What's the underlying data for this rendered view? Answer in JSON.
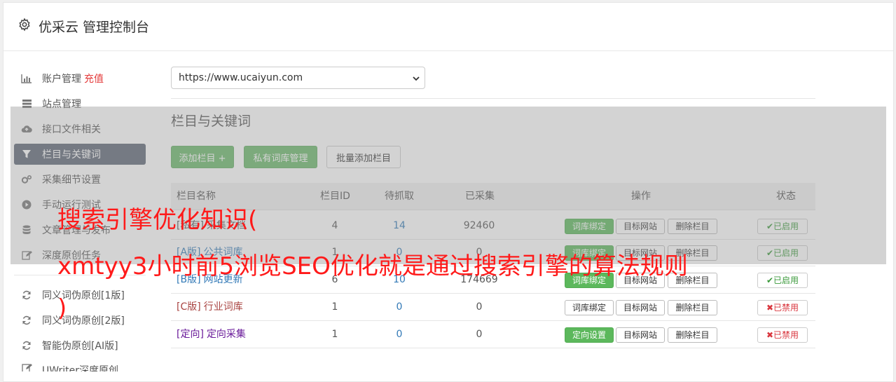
{
  "header": {
    "title": "优采云 管理控制台",
    "icon": "gear-icon"
  },
  "sidebar": {
    "items": [
      {
        "label": "账户管理",
        "highlight": "充值",
        "icon": "bar-chart-icon"
      },
      {
        "label": "站点管理",
        "icon": "server-icon"
      },
      {
        "label": "接口文件相关",
        "icon": "cloud-upload-icon"
      },
      {
        "label": "栏目与关键词",
        "icon": "filter-icon",
        "active": true
      },
      {
        "label": "采集细节设置",
        "icon": "cogs-icon"
      },
      {
        "label": "手动运行测试",
        "icon": "play-circle-icon"
      },
      {
        "label": "文章管理与发布",
        "icon": "database-icon"
      },
      {
        "label": "深度原创任务",
        "icon": "edit-icon"
      },
      {
        "label": "同义词伪原创[1版]",
        "icon": "refresh-icon"
      },
      {
        "label": "同义词伪原创[2版]",
        "icon": "refresh-icon"
      },
      {
        "label": "智能伪原创[AI版]",
        "icon": "refresh-icon"
      },
      {
        "label": "UWriter深度原创",
        "icon": "edit-icon"
      }
    ]
  },
  "site_select": {
    "value": "https://www.ucaiyun.com"
  },
  "section": {
    "title": "栏目与关键词",
    "buttons": {
      "add": "添加栏目 +",
      "private": "私有词库管理",
      "batch": "批量添加栏目"
    }
  },
  "table": {
    "headers": [
      "栏目名称",
      "栏目ID",
      "待抓取",
      "已采集",
      "操作",
      "状态"
    ],
    "rows": [
      {
        "tag": "[私有]",
        "name": "采集文档",
        "tag_color": "#555555",
        "id": "4",
        "pending": "14",
        "collected": "92460",
        "btn1": "词库绑定",
        "btn1_green": true,
        "btn2": "目标网站",
        "btn3": "删除栏目",
        "status": "✔已启用",
        "status_on": true
      },
      {
        "tag": "[A版]",
        "name": "公共词库",
        "tag_color": "#337ab7",
        "id": "1",
        "pending": "0",
        "collected": "0",
        "btn1": "词库绑定",
        "btn1_green": true,
        "btn2": "目标网站",
        "btn3": "删除栏目",
        "status": "✔已启用",
        "status_on": true
      },
      {
        "tag": "[B版]",
        "name": "网站更新",
        "tag_color": "#337ab7",
        "id": "6",
        "pending": "10",
        "collected": "174669",
        "btn1": "词库绑定",
        "btn1_green": true,
        "btn2": "目标网站",
        "btn3": "删除栏目",
        "status": "✔已启用",
        "status_on": true
      },
      {
        "tag": "[C版]",
        "name": "行业词库",
        "tag_color": "#a94442",
        "id": "1",
        "pending": "0",
        "collected": "0",
        "btn1": "词库绑定",
        "btn1_green": false,
        "btn2": "目标网站",
        "btn3": "删除栏目",
        "status": "✖已禁用",
        "status_on": false
      },
      {
        "tag": "[定向]",
        "name": "定向采集",
        "tag_color": "#6a1b9a",
        "id": "1",
        "pending": "0",
        "collected": "0",
        "btn1": "定向设置",
        "btn1_green": true,
        "btn2": "目标网站",
        "btn3": "删除栏目",
        "status": "✖已禁用",
        "status_on": false
      }
    ]
  },
  "overlay_text": {
    "line1": "搜索引擎优化知识(",
    "line2": "xmtyy3小时前5浏览SEO优化就是通过搜索引擎的算法规则",
    "line3": ")"
  }
}
